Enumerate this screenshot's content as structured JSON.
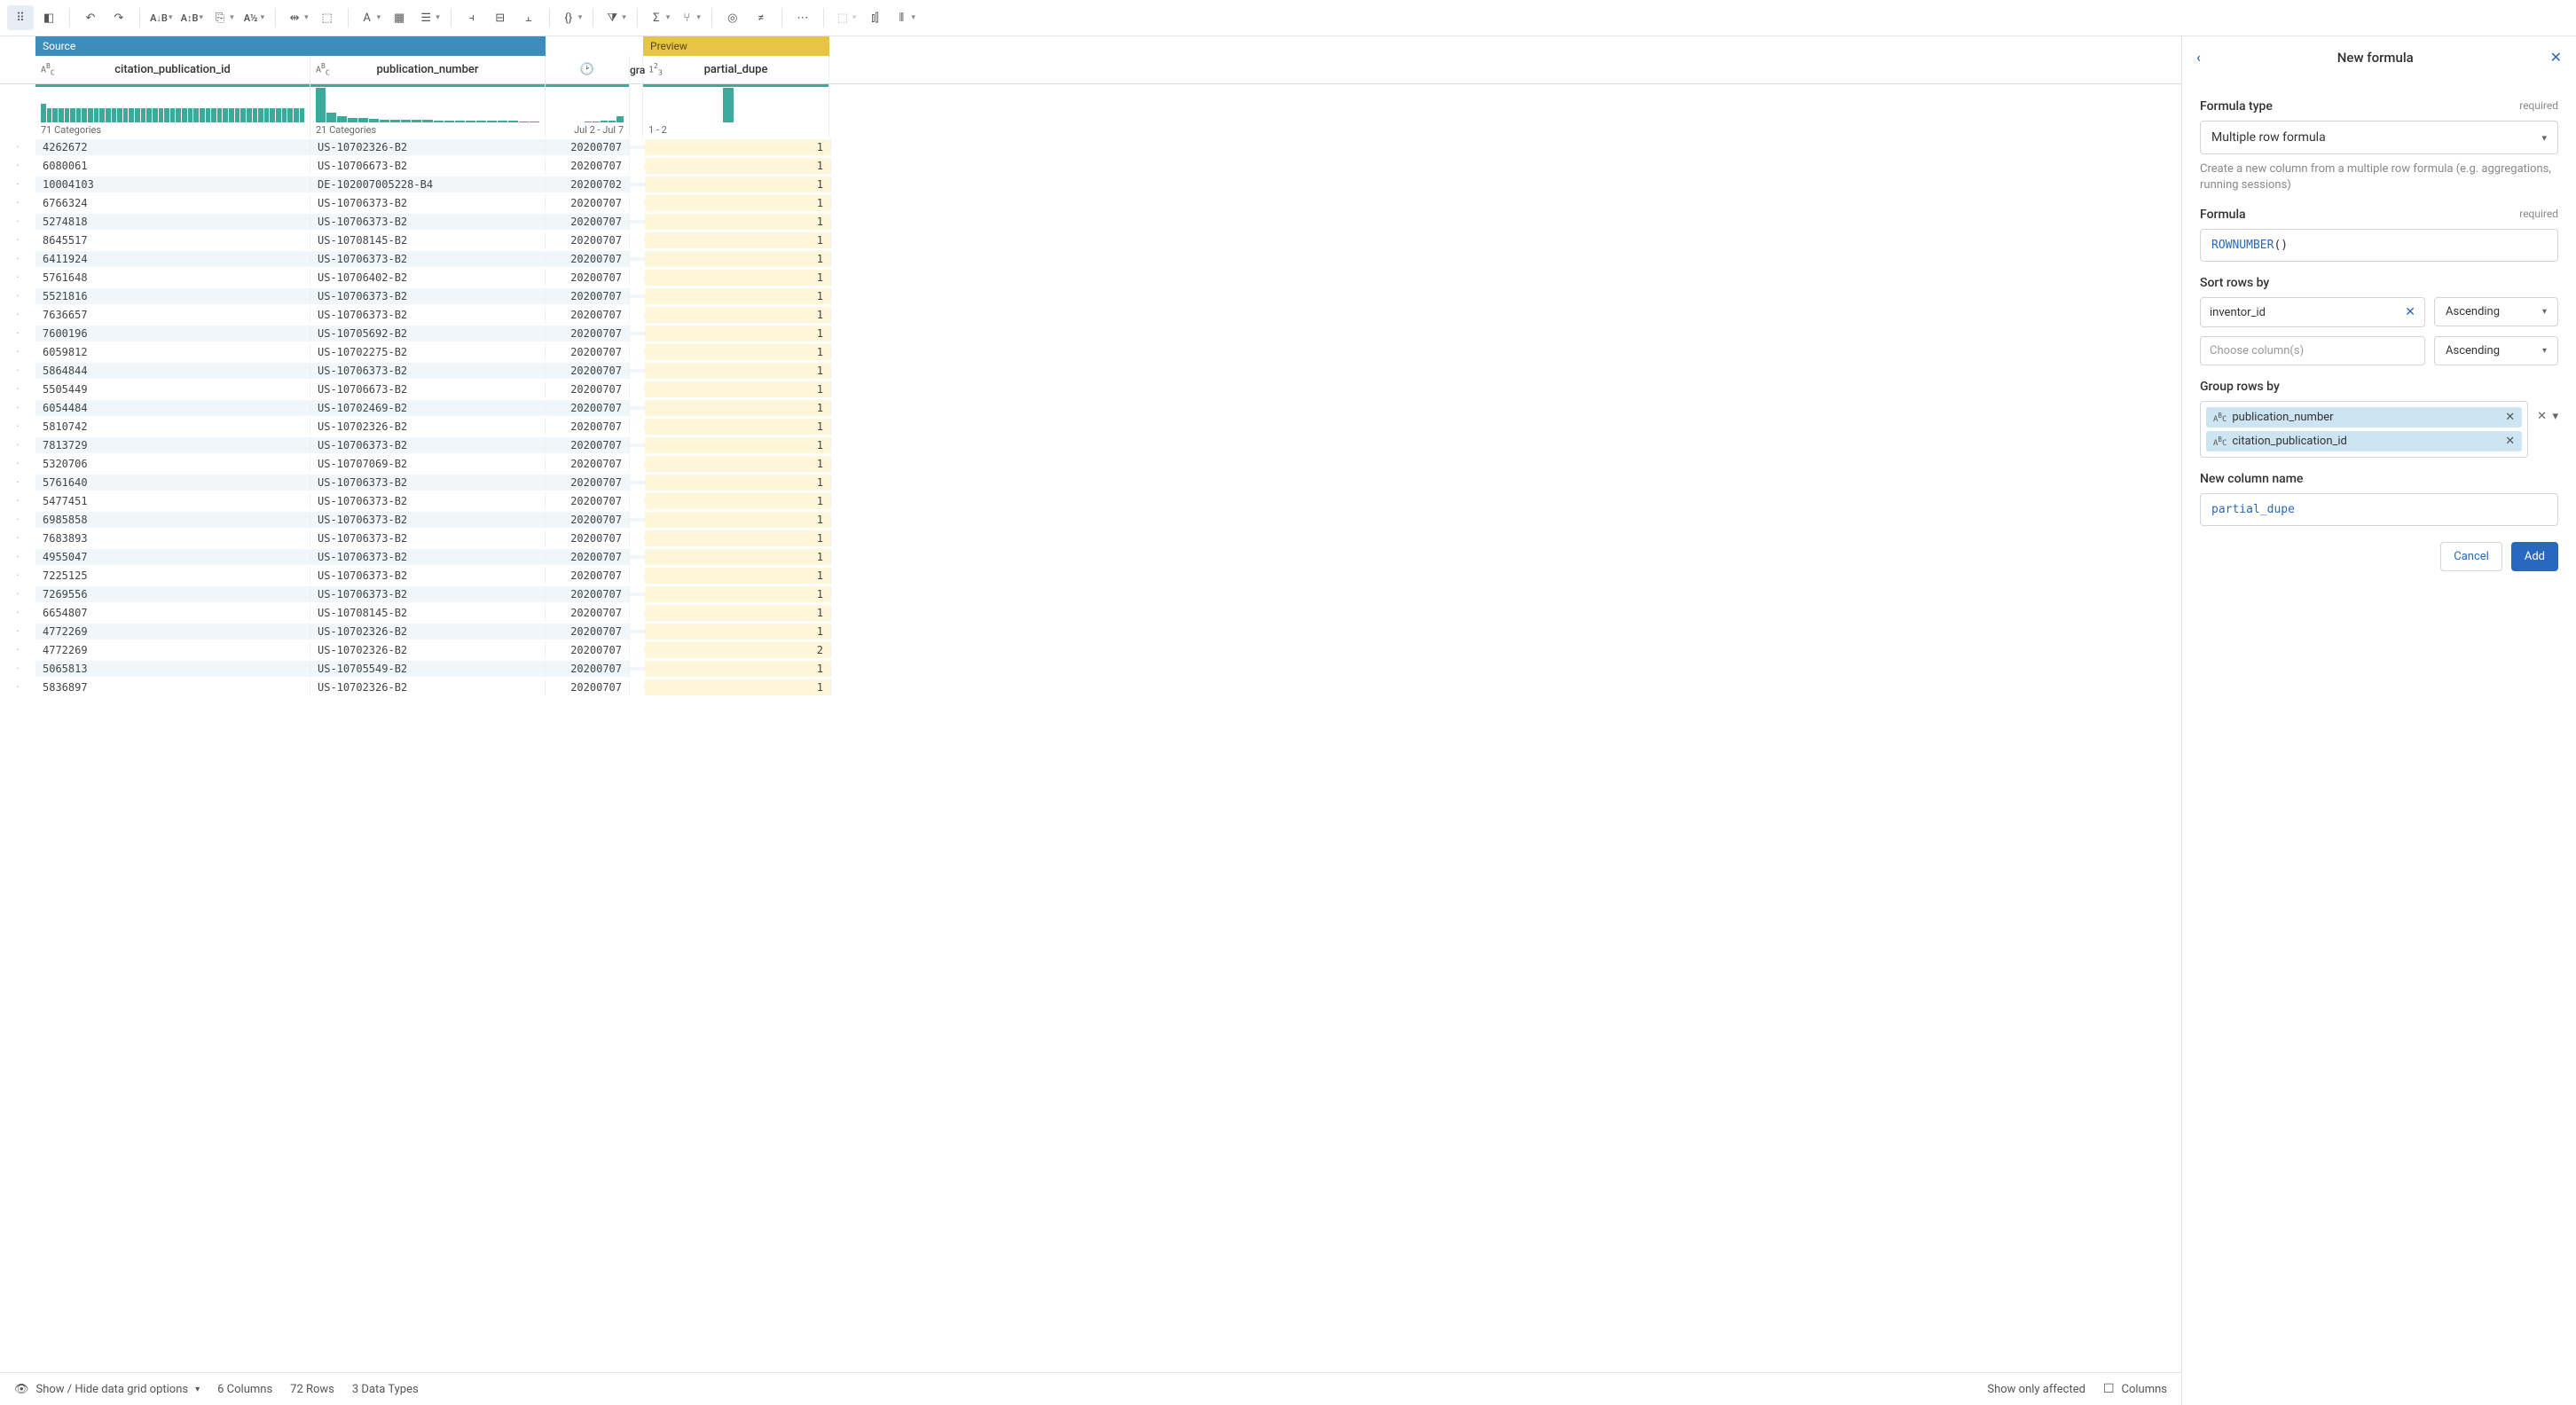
{
  "toolbar": {
    "icons": [
      "grid-apps",
      "layout-panel",
      "undo",
      "redo",
      "text-ab",
      "text-ab-down",
      "export",
      "a12",
      "split-h",
      "expand-col",
      "font",
      "table",
      "rows",
      "col-left",
      "col-mid",
      "col-right",
      "braces",
      "filter",
      "sigma",
      "branch",
      "overlap",
      "not-equal",
      "more",
      "sel-dotted",
      "chart-bars",
      "equalizer"
    ]
  },
  "grid": {
    "source_label": "Source",
    "preview_label": "Preview",
    "columns": {
      "citation_id": {
        "name": "citation_publication_id",
        "summary": "71 Categories",
        "type": "ABC"
      },
      "pub_num": {
        "name": "publication_number",
        "summary": "21 Categories",
        "type": "ABC"
      },
      "grant": {
        "name": "gra",
        "summary": "Jul 2 - Jul 7",
        "type": "clock"
      },
      "dupe": {
        "name": "partial_dupe",
        "summary": "1 - 2",
        "type": "123"
      }
    },
    "rows": [
      {
        "id": "4262672",
        "pub": "US-10702326-B2",
        "date": "20200707",
        "d": "1"
      },
      {
        "id": "6080061",
        "pub": "US-10706673-B2",
        "date": "20200707",
        "d": "1"
      },
      {
        "id": "10004103",
        "pub": "DE-102007005228-B4",
        "date": "20200702",
        "d": "1"
      },
      {
        "id": "6766324",
        "pub": "US-10706373-B2",
        "date": "20200707",
        "d": "1"
      },
      {
        "id": "5274818",
        "pub": "US-10706373-B2",
        "date": "20200707",
        "d": "1"
      },
      {
        "id": "8645517",
        "pub": "US-10708145-B2",
        "date": "20200707",
        "d": "1"
      },
      {
        "id": "6411924",
        "pub": "US-10706373-B2",
        "date": "20200707",
        "d": "1"
      },
      {
        "id": "5761648",
        "pub": "US-10706402-B2",
        "date": "20200707",
        "d": "1"
      },
      {
        "id": "5521816",
        "pub": "US-10706373-B2",
        "date": "20200707",
        "d": "1"
      },
      {
        "id": "7636657",
        "pub": "US-10706373-B2",
        "date": "20200707",
        "d": "1"
      },
      {
        "id": "7600196",
        "pub": "US-10705692-B2",
        "date": "20200707",
        "d": "1"
      },
      {
        "id": "6059812",
        "pub": "US-10702275-B2",
        "date": "20200707",
        "d": "1"
      },
      {
        "id": "5864844",
        "pub": "US-10706373-B2",
        "date": "20200707",
        "d": "1"
      },
      {
        "id": "5505449",
        "pub": "US-10706673-B2",
        "date": "20200707",
        "d": "1"
      },
      {
        "id": "6054484",
        "pub": "US-10702469-B2",
        "date": "20200707",
        "d": "1"
      },
      {
        "id": "5810742",
        "pub": "US-10702326-B2",
        "date": "20200707",
        "d": "1"
      },
      {
        "id": "7813729",
        "pub": "US-10706373-B2",
        "date": "20200707",
        "d": "1"
      },
      {
        "id": "5320706",
        "pub": "US-10707069-B2",
        "date": "20200707",
        "d": "1"
      },
      {
        "id": "5761640",
        "pub": "US-10706373-B2",
        "date": "20200707",
        "d": "1"
      },
      {
        "id": "5477451",
        "pub": "US-10706373-B2",
        "date": "20200707",
        "d": "1"
      },
      {
        "id": "6985858",
        "pub": "US-10706373-B2",
        "date": "20200707",
        "d": "1"
      },
      {
        "id": "7683893",
        "pub": "US-10706373-B2",
        "date": "20200707",
        "d": "1"
      },
      {
        "id": "4955047",
        "pub": "US-10706373-B2",
        "date": "20200707",
        "d": "1"
      },
      {
        "id": "7225125",
        "pub": "US-10706373-B2",
        "date": "20200707",
        "d": "1"
      },
      {
        "id": "7269556",
        "pub": "US-10706373-B2",
        "date": "20200707",
        "d": "1"
      },
      {
        "id": "6654807",
        "pub": "US-10708145-B2",
        "date": "20200707",
        "d": "1"
      },
      {
        "id": "4772269",
        "pub": "US-10702326-B2",
        "date": "20200707",
        "d": "1"
      },
      {
        "id": "4772269",
        "pub": "US-10702326-B2",
        "date": "20200707",
        "d": "2"
      },
      {
        "id": "5065813",
        "pub": "US-10705549-B2",
        "date": "20200707",
        "d": "1"
      },
      {
        "id": "5836897",
        "pub": "US-10702326-B2",
        "date": "20200707",
        "d": "1"
      }
    ]
  },
  "statusbar": {
    "show_hide": "Show / Hide data grid options",
    "cols": "6 Columns",
    "rows": "72 Rows",
    "types": "3 Data Types",
    "affected": "Show only affected",
    "columns_btn": "Columns"
  },
  "panel": {
    "title": "New formula",
    "formula_type": {
      "label": "Formula type",
      "req": "required",
      "value": "Multiple row formula",
      "helper": "Create a new column from a multiple row formula (e.g. aggregations, running sessions)"
    },
    "formula": {
      "label": "Formula",
      "req": "required",
      "fn": "ROWNUMBER",
      "parens": "()"
    },
    "sort": {
      "label": "Sort rows by",
      "rows": [
        {
          "col": "inventor_id",
          "dir": "Ascending",
          "has_value": true
        },
        {
          "placeholder": "Choose column(s)",
          "dir": "Ascending",
          "has_value": false
        }
      ]
    },
    "group": {
      "label": "Group rows by",
      "tags": [
        {
          "name": "publication_number"
        },
        {
          "name": "citation_publication_id"
        }
      ]
    },
    "newcol": {
      "label": "New column name",
      "value": "partial_dupe"
    },
    "buttons": {
      "cancel": "Cancel",
      "add": "Add"
    }
  }
}
